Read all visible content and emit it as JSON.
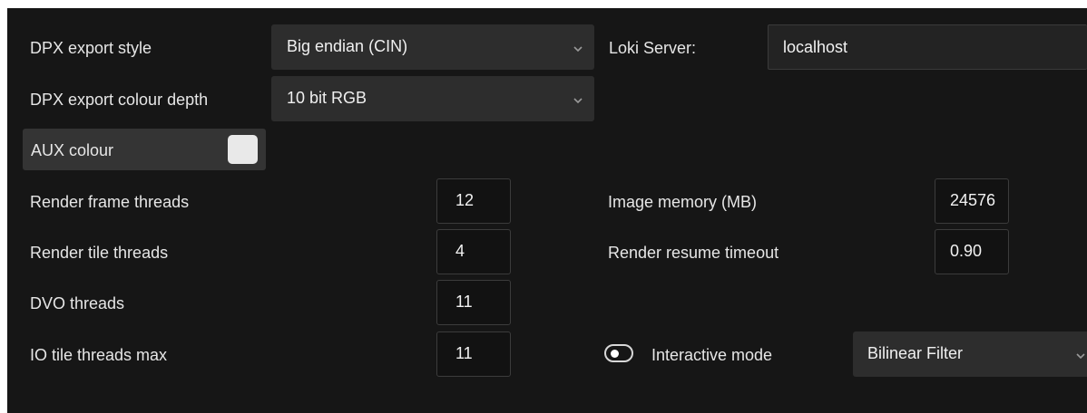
{
  "left_column": {
    "dpx_export_style_label": "DPX export style",
    "dpx_export_style_value": "Big endian (CIN)",
    "dpx_colour_depth_label": "DPX export colour depth",
    "dpx_colour_depth_value": "10 bit RGB",
    "aux_colour_label": "AUX colour",
    "aux_colour_value": "#e9e9e9",
    "render_frame_threads_label": "Render frame threads",
    "render_frame_threads_value": "12",
    "render_tile_threads_label": "Render tile threads",
    "render_tile_threads_value": "4",
    "dvo_threads_label": "DVO threads",
    "dvo_threads_value": "11",
    "io_tile_threads_label": "IO tile threads max",
    "io_tile_threads_value": "11"
  },
  "right_column": {
    "loki_server_label": "Loki Server:",
    "loki_server_value": "localhost",
    "image_memory_label": "Image memory (MB)",
    "image_memory_value": "24576",
    "render_resume_timeout_label": "Render resume timeout",
    "render_resume_timeout_value": "0.90",
    "interactive_mode_label": "Interactive mode",
    "interactive_mode_on": false,
    "interactive_filter_value": "Bilinear Filter"
  },
  "icons": {
    "dropdown": "chevron-down-icon",
    "toggle": "toggle-switch-icon"
  },
  "colors": {
    "panel_background": "#161616",
    "combo_background": "#2d2d2d",
    "text": "#e6e6e6"
  }
}
